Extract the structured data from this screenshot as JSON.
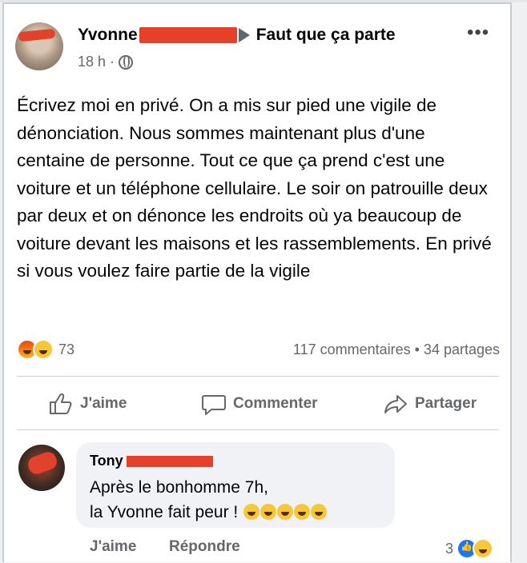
{
  "post": {
    "author_first": "Yvonne",
    "group_name": "Faut que ça parte",
    "time": "18 h",
    "separator": "·",
    "more": "•••",
    "text": "Écrivez moi en privé. On a mis sur pied une vigile de dénonciation. Nous sommes maintenant plus d'une centaine de personne. Tout ce que ça prend c'est une voiture et un téléphone cellulaire. Le soir on patrouille deux par deux et on dénonce les endroits où ya beaucoup de voiture devant les maisons et les rassemblements. En privé si vous voulez faire partie de la vigile",
    "reaction_count": "73",
    "comments_shares": "117 commentaires • 34 partages"
  },
  "actions": {
    "like": "J'aime",
    "comment": "Commenter",
    "share": "Partager"
  },
  "comment": {
    "author_first": "Tony",
    "line1": "Après le bonhomme 7h,",
    "line2": "la Yvonne fait peur !",
    "like": "J'aime",
    "reply": "Répondre",
    "reaction_count": "3"
  },
  "colors": {
    "redaction": "#e6402a",
    "secondary_text": "#65676b",
    "bubble": "#f0f2f5",
    "like_blue": "#1877f2"
  }
}
